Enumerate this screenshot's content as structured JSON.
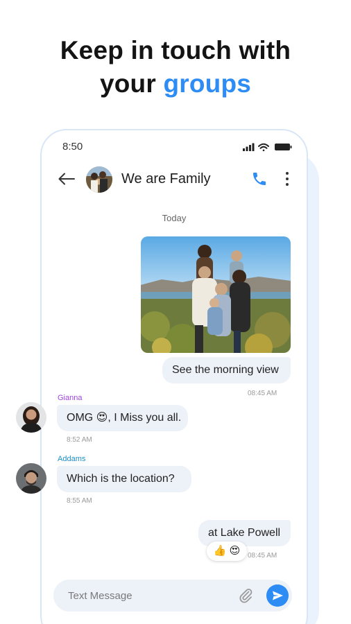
{
  "headline": {
    "line1": "Keep in touch with",
    "line2_prefix": "your ",
    "line2_accent": "groups"
  },
  "colors": {
    "accent": "#2e8cf5",
    "bubble_bg": "#edf1f8",
    "gianna_name": "#9b44e0",
    "addams_name": "#1b8fc9"
  },
  "status_bar": {
    "time": "8:50",
    "icons": [
      "signal-icon",
      "wifi-icon",
      "battery-icon"
    ]
  },
  "header": {
    "title": "We are Family",
    "back_icon": "arrow-left-icon",
    "call_icon": "phone-icon",
    "more_icon": "more-vertical-icon"
  },
  "chat": {
    "day_label": "Today",
    "messages": [
      {
        "type": "image",
        "direction": "outgoing",
        "alt": "family-photo"
      },
      {
        "type": "text",
        "direction": "outgoing",
        "text": "See the morning view",
        "time": "08:45 AM"
      },
      {
        "type": "text",
        "direction": "incoming",
        "sender": "Gianna",
        "text": "OMG 😍, I Miss you all.",
        "time": "8:52 AM"
      },
      {
        "type": "text",
        "direction": "incoming",
        "sender": "Addams",
        "text": "Which is the location?",
        "time": "8:55 AM"
      },
      {
        "type": "text",
        "direction": "outgoing",
        "text": "at Lake Powell",
        "time": "08:45 AM",
        "reactions": "👍 😍"
      }
    ]
  },
  "composer": {
    "placeholder": "Text Message",
    "attach_icon": "paperclip-icon",
    "send_icon": "send-icon"
  }
}
